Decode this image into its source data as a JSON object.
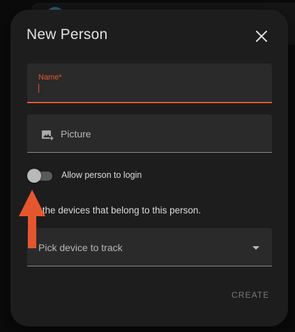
{
  "dialog": {
    "title": "New Person",
    "close_icon": "close-icon"
  },
  "name_field": {
    "label": "Name*",
    "value": ""
  },
  "picture_field": {
    "label": "Picture",
    "icon": "add-photo-icon"
  },
  "login_toggle": {
    "label": "Allow person to login",
    "checked": false
  },
  "devices": {
    "description": "ect the devices that belong to this person.",
    "picker_label": "Pick device to track",
    "dropdown_icon": "chevron-down-icon"
  },
  "actions": {
    "create_label": "CREATE"
  },
  "annotation": {
    "arrow_color": "#e4572e",
    "points_to": "login toggle"
  },
  "colors": {
    "accent": "#e4572e",
    "dialog_bg": "#1d1d1d",
    "field_bg": "#2a2a2a"
  }
}
